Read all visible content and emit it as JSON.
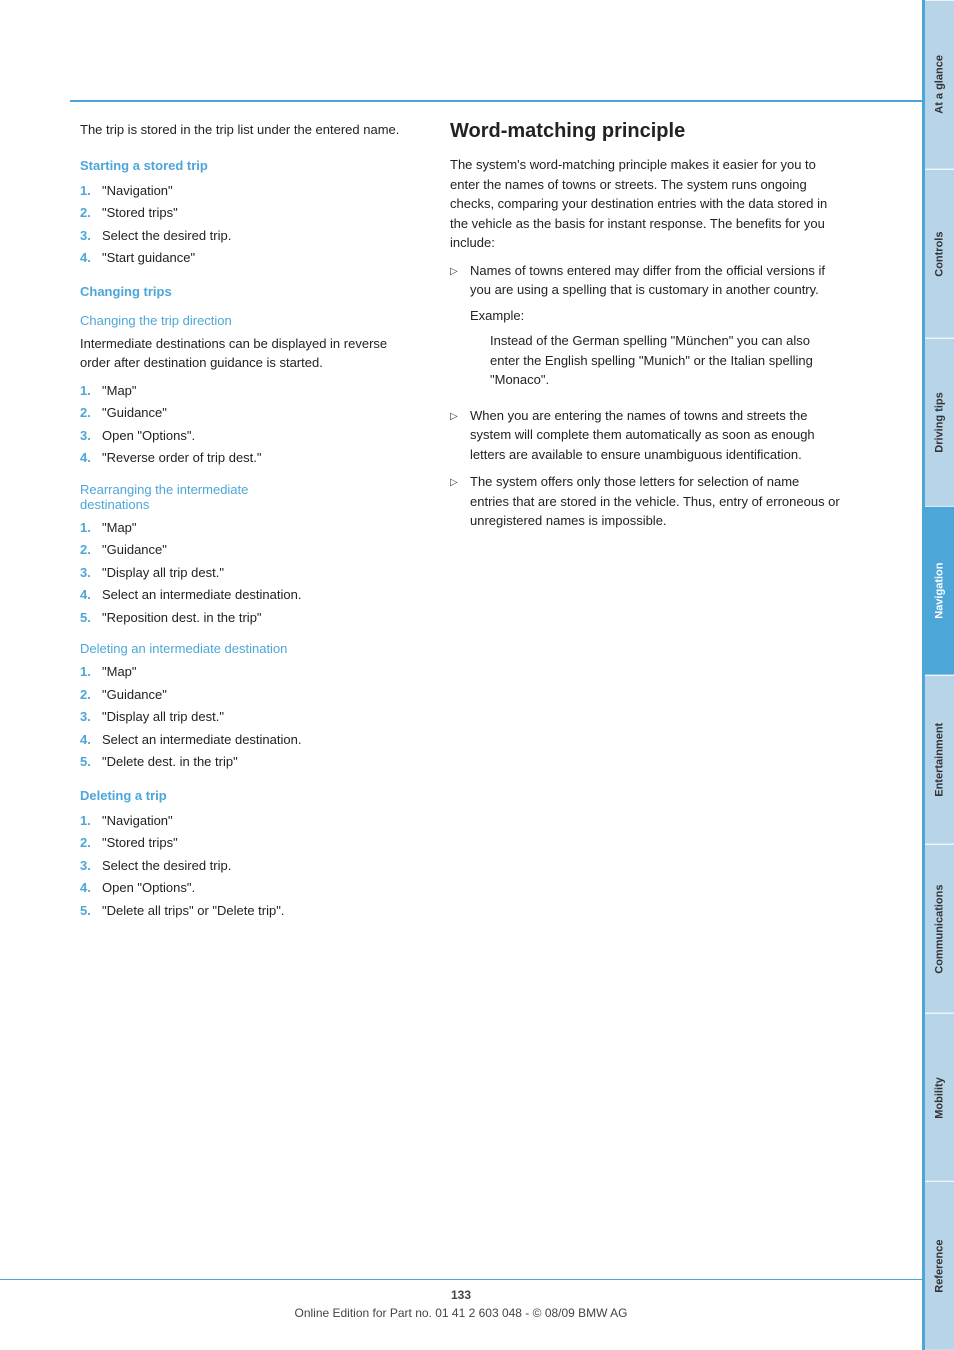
{
  "page": {
    "number": "133",
    "footer_text": "Online Edition for Part no. 01 41 2 603 048 - © 08/09 BMW AG"
  },
  "left_column": {
    "intro_text": "The trip is stored in the trip list under the entered name.",
    "sections": [
      {
        "id": "starting-stored-trip",
        "heading": "Starting a stored trip",
        "steps": [
          {
            "num": "1.",
            "text": "\"Navigation\""
          },
          {
            "num": "2.",
            "text": "\"Stored trips\""
          },
          {
            "num": "3.",
            "text": "Select the desired trip."
          },
          {
            "num": "4.",
            "text": "\"Start guidance\""
          }
        ]
      },
      {
        "id": "changing-trips",
        "heading": "Changing trips",
        "sub_sections": [
          {
            "id": "changing-trip-direction",
            "sub_heading": "Changing the trip direction",
            "body": "Intermediate destinations can be displayed in reverse order after destination guidance is started.",
            "steps": [
              {
                "num": "1.",
                "text": "\"Map\""
              },
              {
                "num": "2.",
                "text": "\"Guidance\""
              },
              {
                "num": "3.",
                "text": "Open \"Options\"."
              },
              {
                "num": "4.",
                "text": "\"Reverse order of trip dest.\""
              }
            ]
          },
          {
            "id": "rearranging-intermediate",
            "sub_heading": "Rearranging the intermediate destinations",
            "steps": [
              {
                "num": "1.",
                "text": "\"Map\""
              },
              {
                "num": "2.",
                "text": "\"Guidance\""
              },
              {
                "num": "3.",
                "text": "\"Display all trip dest.\""
              },
              {
                "num": "4.",
                "text": "Select an intermediate destination."
              },
              {
                "num": "5.",
                "text": "\"Reposition dest. in the trip\""
              }
            ]
          },
          {
            "id": "deleting-intermediate",
            "sub_heading": "Deleting an intermediate destination",
            "steps": [
              {
                "num": "1.",
                "text": "\"Map\""
              },
              {
                "num": "2.",
                "text": "\"Guidance\""
              },
              {
                "num": "3.",
                "text": "\"Display all trip dest.\""
              },
              {
                "num": "4.",
                "text": "Select an intermediate destination."
              },
              {
                "num": "5.",
                "text": "\"Delete dest. in the trip\""
              }
            ]
          }
        ]
      },
      {
        "id": "deleting-trip",
        "heading": "Deleting a trip",
        "steps": [
          {
            "num": "1.",
            "text": "\"Navigation\""
          },
          {
            "num": "2.",
            "text": "\"Stored trips\""
          },
          {
            "num": "3.",
            "text": "Select the desired trip."
          },
          {
            "num": "4.",
            "text": "Open \"Options\"."
          },
          {
            "num": "5.",
            "text": "\"Delete all trips\" or \"Delete trip\"."
          }
        ]
      }
    ]
  },
  "right_column": {
    "title": "Word-matching principle",
    "intro": "The system's word-matching principle makes it easier for you to enter the names of towns or streets. The system runs ongoing checks, comparing your destination entries with the data stored in the vehicle as the basis for instant response. The benefits for you include:",
    "bullets": [
      {
        "id": "bullet-1",
        "text": "Names of towns entered may differ from the official versions if you are using a spelling that is customary in another country.",
        "example_label": "Example:",
        "example_text": "Instead of the German spelling \"München\" you can also enter the English spelling \"Munich\" or the Italian spelling \"Monaco\"."
      },
      {
        "id": "bullet-2",
        "text": "When you are entering the names of towns and streets the system will complete them automatically as soon as enough letters are available to ensure unambiguous identification."
      },
      {
        "id": "bullet-3",
        "text": "The system offers only those letters for selection of name entries that are stored in the vehicle. Thus, entry of erroneous or unregistered names is impossible."
      }
    ]
  },
  "sidebar": {
    "tabs": [
      {
        "id": "at-a-glance",
        "label": "At a glance",
        "active": false
      },
      {
        "id": "controls",
        "label": "Controls",
        "active": false
      },
      {
        "id": "driving-tips",
        "label": "Driving tips",
        "active": false
      },
      {
        "id": "navigation",
        "label": "Navigation",
        "active": true
      },
      {
        "id": "entertainment",
        "label": "Entertainment",
        "active": false
      },
      {
        "id": "communications",
        "label": "Communications",
        "active": false
      },
      {
        "id": "mobility",
        "label": "Mobility",
        "active": false
      },
      {
        "id": "reference",
        "label": "Reference",
        "active": false
      }
    ]
  }
}
